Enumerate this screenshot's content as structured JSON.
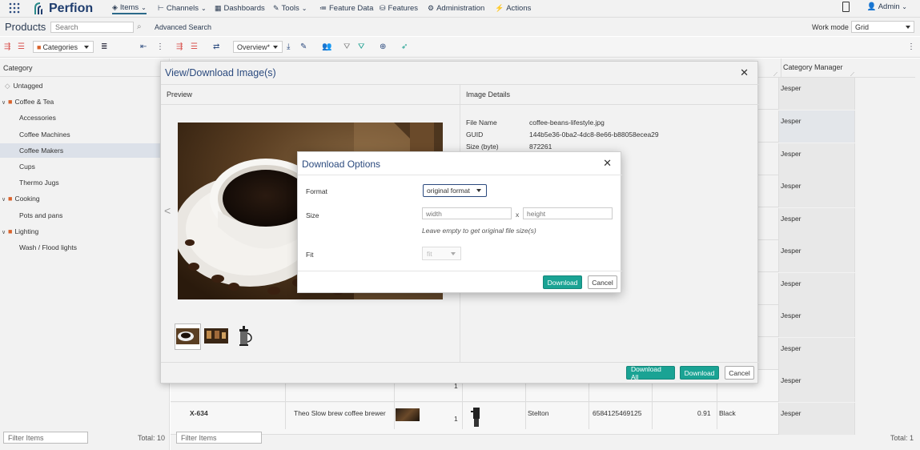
{
  "topnav": {
    "logo": "Perfion",
    "items": [
      {
        "label": "Items",
        "icon": "cube-icon",
        "chevron": "⌄"
      },
      {
        "label": "Channels",
        "icon": "channels-icon",
        "chevron": "⌄"
      },
      {
        "label": "Dashboards",
        "icon": "dashboard-icon"
      },
      {
        "label": "Tools",
        "icon": "wrench-icon",
        "chevron": "⌄"
      },
      {
        "label": "Feature Data",
        "icon": "list-icon"
      },
      {
        "label": "Features",
        "icon": "database-icon"
      },
      {
        "label": "Administration",
        "icon": "gear-icon"
      },
      {
        "label": "Actions",
        "icon": "actions-icon"
      }
    ],
    "admin": "Admin"
  },
  "bar2": {
    "title": "Products",
    "search_placeholder": "Search",
    "advanced_search": "Advanced Search",
    "work_mode_label": "Work mode",
    "work_mode_value": "Grid"
  },
  "toolbar": {
    "category_select": "Categories",
    "view_select": "Overview*"
  },
  "left": {
    "header": "Category",
    "items": [
      {
        "label": "Untagged"
      },
      {
        "label": "Coffee & Tea"
      },
      {
        "label": "Accessories"
      },
      {
        "label": "Coffee Machines"
      },
      {
        "label": "Coffee Makers"
      },
      {
        "label": "Cups"
      },
      {
        "label": "Thermo Jugs"
      },
      {
        "label": "Cooking"
      },
      {
        "label": "Pots and pans"
      },
      {
        "label": "Lighting"
      },
      {
        "label": "Wash / Flood lights"
      }
    ],
    "filter_placeholder": "Filter Items",
    "total": "Total: 10"
  },
  "main": {
    "category_manager_header": "Category Manager",
    "manager_name": "Jesper",
    "last_row": {
      "id": "X-634",
      "name": "Theo Slow brew coffee brewer",
      "count": "1",
      "brand": "Stelton",
      "ean": "6584125469125",
      "value": "0.91",
      "color": "Black",
      "manager": "Jesper"
    },
    "prev_row_count": "1",
    "filter_placeholder": "Filter Items",
    "total": "Total: 1"
  },
  "dialog": {
    "title": "View/Download Image(s)",
    "preview_label": "Preview",
    "details_label": "Image Details",
    "details": [
      {
        "label": "File Name",
        "value": "coffee-beans-lifestyle.jpg"
      },
      {
        "label": "GUID",
        "value": "144b5e36-0ba2-4dc8-8e66-b88058ecea29"
      },
      {
        "label": "Size (byte)",
        "value": "872261"
      }
    ],
    "download_all": "Download All",
    "download": "Download",
    "cancel": "Cancel"
  },
  "options": {
    "title": "Download Options",
    "format_label": "Format",
    "format_value": "original format",
    "size_label": "Size",
    "width_placeholder": "width",
    "x_sep": "x",
    "height_placeholder": "height",
    "hint": "Leave empty to get original file size(s)",
    "fit_label": "Fit",
    "fit_value": "fit",
    "download": "Download",
    "cancel": "Cancel"
  }
}
